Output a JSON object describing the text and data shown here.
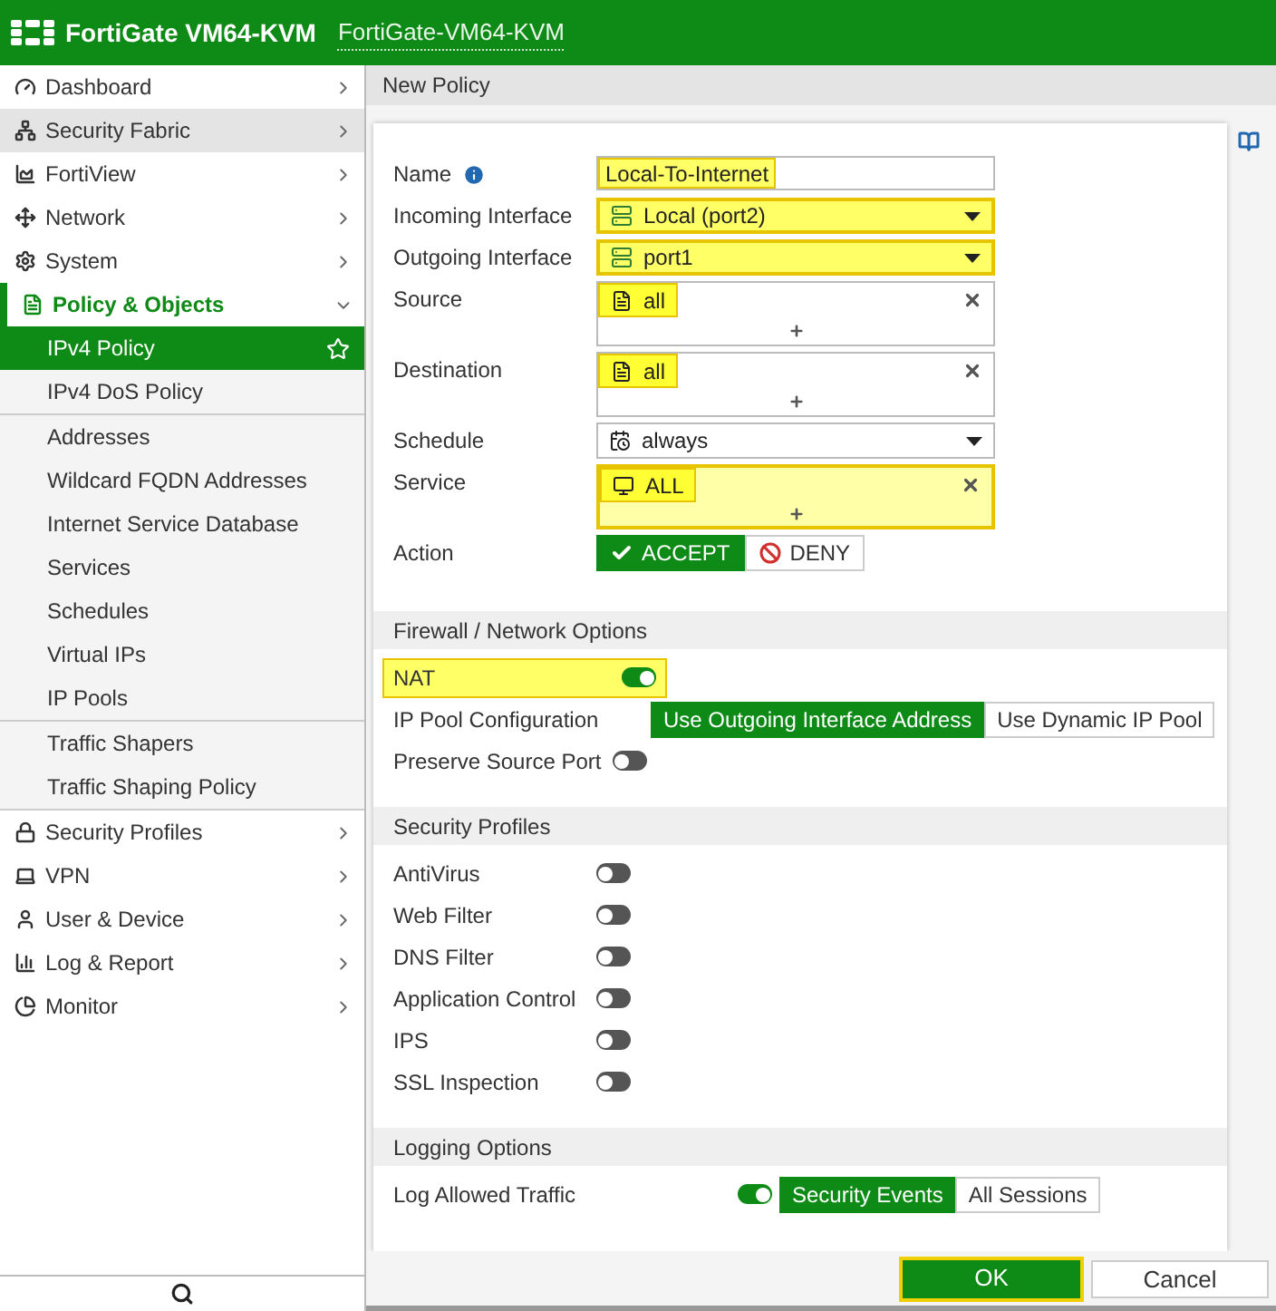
{
  "header": {
    "product": "FortiGate VM64-KVM",
    "hostname": "FortiGate-VM64-KVM"
  },
  "sidebar": {
    "items": [
      {
        "label": "Dashboard",
        "kind": "dashboard",
        "selected": false,
        "hovered": false,
        "expanded": false
      },
      {
        "label": "Security Fabric",
        "kind": "fabric",
        "selected": false,
        "hovered": true,
        "expanded": false
      },
      {
        "label": "FortiView",
        "kind": "fortiview",
        "selected": false,
        "hovered": false,
        "expanded": false
      },
      {
        "label": "Network",
        "kind": "network",
        "selected": false,
        "hovered": false,
        "expanded": false
      },
      {
        "label": "System",
        "kind": "system",
        "selected": false,
        "hovered": false,
        "expanded": false
      },
      {
        "label": "Policy & Objects",
        "kind": "policy",
        "selected": true,
        "hovered": false,
        "expanded": true,
        "groups": [
          {
            "items": [
              {
                "label": "IPv4 Policy",
                "selected": true
              },
              {
                "label": "IPv4 DoS Policy",
                "selected": false
              }
            ]
          },
          {
            "items": [
              {
                "label": "Addresses",
                "selected": false
              },
              {
                "label": "Wildcard FQDN Addresses",
                "selected": false
              },
              {
                "label": "Internet Service Database",
                "selected": false
              },
              {
                "label": "Services",
                "selected": false
              },
              {
                "label": "Schedules",
                "selected": false
              },
              {
                "label": "Virtual IPs",
                "selected": false
              },
              {
                "label": "IP Pools",
                "selected": false
              }
            ]
          },
          {
            "items": [
              {
                "label": "Traffic Shapers",
                "selected": false
              },
              {
                "label": "Traffic Shaping Policy",
                "selected": false
              }
            ]
          }
        ]
      },
      {
        "label": "Security Profiles",
        "kind": "profiles",
        "selected": false,
        "hovered": false,
        "expanded": false
      },
      {
        "label": "VPN",
        "kind": "vpn",
        "selected": false,
        "hovered": false,
        "expanded": false
      },
      {
        "label": "User & Device",
        "kind": "user",
        "selected": false,
        "hovered": false,
        "expanded": false
      },
      {
        "label": "Log & Report",
        "kind": "log",
        "selected": false,
        "hovered": false,
        "expanded": false
      },
      {
        "label": "Monitor",
        "kind": "monitor",
        "selected": false,
        "hovered": false,
        "expanded": false
      }
    ]
  },
  "page_title": "New Policy",
  "form": [
    {
      "label": "Name",
      "kind": "text",
      "value": "Local-To-Internet",
      "info": true,
      "highlighted": false,
      "value_highlighted": true
    },
    {
      "label": "Incoming Interface",
      "kind": "interface-select",
      "value": "Local (port2)",
      "highlighted": true
    },
    {
      "label": "Outgoing Interface",
      "kind": "interface-select",
      "value": "port1",
      "highlighted": true
    },
    {
      "label": "Source",
      "kind": "address-list",
      "highlighted": false,
      "entries": [
        {
          "text": "all",
          "highlighted": true
        }
      ]
    },
    {
      "label": "Destination",
      "kind": "address-list",
      "highlighted": false,
      "entries": [
        {
          "text": "all",
          "highlighted": true
        }
      ]
    },
    {
      "label": "Schedule",
      "kind": "schedule-select",
      "value": "always",
      "highlighted": false
    },
    {
      "label": "Service",
      "kind": "service-list",
      "highlighted": true,
      "entries": [
        {
          "text": "ALL",
          "highlighted": true
        }
      ]
    },
    {
      "label": "Action",
      "kind": "action",
      "options": [
        {
          "label": "ACCEPT",
          "kind": "accept",
          "selected": true
        },
        {
          "label": "DENY",
          "kind": "deny",
          "selected": false
        }
      ]
    }
  ],
  "sections": [
    {
      "title": "Firewall / Network Options",
      "rows": [
        {
          "label": "NAT",
          "kind": "toggle",
          "on": true,
          "highlighted": true
        },
        {
          "label": "IP Pool Configuration",
          "kind": "segmented",
          "options": [
            {
              "label": "Use Outgoing Interface Address",
              "selected": true
            },
            {
              "label": "Use Dynamic IP Pool",
              "selected": false
            }
          ]
        },
        {
          "label": "Preserve Source Port",
          "kind": "toggle",
          "on": false,
          "highlighted": false
        }
      ]
    },
    {
      "title": "Security Profiles",
      "rows": [
        {
          "label": "AntiVirus",
          "kind": "toggle",
          "on": false,
          "highlighted": false
        },
        {
          "label": "Web Filter",
          "kind": "toggle",
          "on": false,
          "highlighted": false
        },
        {
          "label": "DNS Filter",
          "kind": "toggle",
          "on": false,
          "highlighted": false
        },
        {
          "label": "Application Control",
          "kind": "toggle",
          "on": false,
          "highlighted": false
        },
        {
          "label": "IPS",
          "kind": "toggle",
          "on": false,
          "highlighted": false
        },
        {
          "label": "SSL Inspection",
          "kind": "toggle",
          "on": false,
          "highlighted": false
        }
      ]
    },
    {
      "title": "Logging Options",
      "rows": [
        {
          "label": "Log Allowed Traffic",
          "kind": "toggle-segmented",
          "on": true,
          "highlighted": false,
          "options": [
            {
              "label": "Security Events",
              "selected": true
            },
            {
              "label": "All Sessions",
              "selected": false
            }
          ]
        }
      ]
    }
  ],
  "footer": [
    {
      "label": "OK",
      "primary": true,
      "highlighted": true
    },
    {
      "label": "Cancel",
      "primary": false,
      "highlighted": false
    }
  ]
}
